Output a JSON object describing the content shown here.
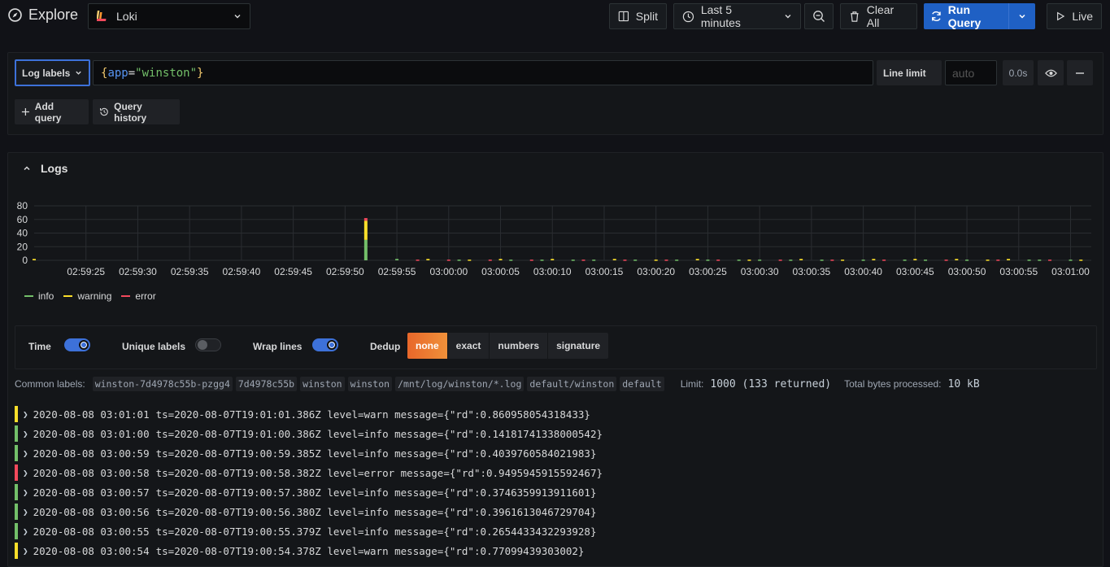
{
  "topbar": {
    "title": "Explore",
    "datasource": "Loki",
    "split_label": "Split",
    "time_range": "Last 5 minutes",
    "clear_all_label": "Clear All",
    "run_query_label": "Run Query",
    "live_label": "Live"
  },
  "query": {
    "log_labels_label": "Log labels",
    "expr_open": "{",
    "expr_key": "app",
    "expr_eq": "=",
    "expr_value": "\"winston\"",
    "expr_close": "}",
    "line_limit_label": "Line limit",
    "line_limit_placeholder": "auto",
    "query_time": "0.0s",
    "add_query_label": "Add query",
    "query_history_label": "Query history"
  },
  "logs": {
    "title": "Logs",
    "options": {
      "time_label": "Time",
      "time_on": true,
      "unique_labels_label": "Unique labels",
      "unique_labels_on": false,
      "wrap_lines_label": "Wrap lines",
      "wrap_lines_on": true,
      "dedup_label": "Dedup",
      "dedup_options": [
        "none",
        "exact",
        "numbers",
        "signature"
      ],
      "dedup_selected": "none"
    },
    "common_labels_label": "Common labels:",
    "common_labels": [
      "winston-7d4978c55b-pzgg4",
      "7d4978c55b",
      "winston",
      "winston",
      "/mnt/log/winston/*.log",
      "default/winston",
      "default"
    ],
    "limit_label": "Limit:",
    "limit_value": "1000 (133 returned)",
    "bytes_label": "Total bytes processed:",
    "bytes_value": "10 kB",
    "rows": [
      {
        "level": "warn",
        "time": "2020-08-08 03:01:01",
        "line": "ts=2020-08-07T19:01:01.386Z level=warn message={\"rd\":0.860958054318433}"
      },
      {
        "level": "info",
        "time": "2020-08-08 03:01:00",
        "line": "ts=2020-08-07T19:01:00.386Z level=info message={\"rd\":0.14181741338000542}"
      },
      {
        "level": "info",
        "time": "2020-08-08 03:00:59",
        "line": "ts=2020-08-07T19:00:59.385Z level=info message={\"rd\":0.4039760584021983}"
      },
      {
        "level": "error",
        "time": "2020-08-08 03:00:58",
        "line": "ts=2020-08-07T19:00:58.382Z level=error message={\"rd\":0.9495945915592467}"
      },
      {
        "level": "info",
        "time": "2020-08-08 03:00:57",
        "line": "ts=2020-08-07T19:00:57.380Z level=info message={\"rd\":0.3746359913911601}"
      },
      {
        "level": "info",
        "time": "2020-08-08 03:00:56",
        "line": "ts=2020-08-07T19:00:56.380Z level=info message={\"rd\":0.3961613046729704}"
      },
      {
        "level": "info",
        "time": "2020-08-08 03:00:55",
        "line": "ts=2020-08-07T19:00:55.379Z level=info message={\"rd\":0.2654433432293928}"
      },
      {
        "level": "warn",
        "time": "2020-08-08 03:00:54",
        "line": "ts=2020-08-07T19:00:54.378Z level=warn message={\"rd\":0.77099439303002}"
      }
    ]
  },
  "colors": {
    "info": "#73bf69",
    "warn": "#fade2a",
    "error": "#f2495c",
    "accent": "#3d71d9"
  },
  "chart_data": {
    "type": "bar",
    "stacked": true,
    "ylim": [
      0,
      80
    ],
    "yticks": [
      0,
      20,
      40,
      60,
      80
    ],
    "x_tick_labels": [
      "02:59:25",
      "02:59:30",
      "02:59:35",
      "02:59:40",
      "02:59:45",
      "02:59:50",
      "02:59:55",
      "03:00:00",
      "03:00:05",
      "03:00:10",
      "03:00:15",
      "03:00:20",
      "03:00:25",
      "03:00:30",
      "03:00:35",
      "03:00:40",
      "03:00:45",
      "03:00:50",
      "03:00:55",
      "03:01:00"
    ],
    "x_start": "02:59:20",
    "x_end": "03:01:02",
    "grid": true,
    "legend_placement": "bottom-left",
    "series": [
      {
        "name": "info",
        "color": "#73bf69"
      },
      {
        "name": "warning",
        "color": "#fade2a"
      },
      {
        "name": "error",
        "color": "#f2495c"
      }
    ],
    "bars": [
      {
        "t": "02:59:20",
        "info": 0,
        "warning": 2,
        "error": 0
      },
      {
        "t": "02:59:52",
        "info": 30,
        "warning": 28,
        "error": 4
      },
      {
        "t": "02:59:55",
        "info": 2,
        "warning": 0,
        "error": 0
      },
      {
        "t": "02:59:57",
        "info": 0,
        "warning": 0,
        "error": 1
      },
      {
        "t": "02:59:58",
        "info": 0,
        "warning": 2,
        "error": 0
      },
      {
        "t": "03:00:00",
        "info": 0,
        "warning": 0,
        "error": 1
      },
      {
        "t": "03:00:01",
        "info": 1,
        "warning": 0,
        "error": 0
      },
      {
        "t": "03:00:02",
        "info": 0,
        "warning": 1,
        "error": 0
      },
      {
        "t": "03:00:04",
        "info": 0,
        "warning": 0,
        "error": 1
      },
      {
        "t": "03:00:05",
        "info": 0,
        "warning": 2,
        "error": 0
      },
      {
        "t": "03:00:06",
        "info": 1,
        "warning": 0,
        "error": 0
      },
      {
        "t": "03:00:08",
        "info": 0,
        "warning": 0,
        "error": 1
      },
      {
        "t": "03:00:09",
        "info": 1,
        "warning": 0,
        "error": 0
      },
      {
        "t": "03:00:10",
        "info": 0,
        "warning": 2,
        "error": 0
      },
      {
        "t": "03:00:12",
        "info": 1,
        "warning": 0,
        "error": 0
      },
      {
        "t": "03:00:13",
        "info": 0,
        "warning": 0,
        "error": 1
      },
      {
        "t": "03:00:14",
        "info": 1,
        "warning": 0,
        "error": 0
      },
      {
        "t": "03:00:16",
        "info": 0,
        "warning": 2,
        "error": 0
      },
      {
        "t": "03:00:17",
        "info": 0,
        "warning": 0,
        "error": 1
      },
      {
        "t": "03:00:18",
        "info": 1,
        "warning": 0,
        "error": 0
      },
      {
        "t": "03:00:20",
        "info": 0,
        "warning": 1,
        "error": 0
      },
      {
        "t": "03:00:21",
        "info": 0,
        "warning": 0,
        "error": 1
      },
      {
        "t": "03:00:22",
        "info": 1,
        "warning": 0,
        "error": 0
      },
      {
        "t": "03:00:24",
        "info": 0,
        "warning": 2,
        "error": 0
      },
      {
        "t": "03:00:25",
        "info": 1,
        "warning": 0,
        "error": 0
      },
      {
        "t": "03:00:26",
        "info": 0,
        "warning": 0,
        "error": 1
      },
      {
        "t": "03:00:28",
        "info": 1,
        "warning": 0,
        "error": 0
      },
      {
        "t": "03:00:29",
        "info": 0,
        "warning": 1,
        "error": 0
      },
      {
        "t": "03:00:30",
        "info": 1,
        "warning": 0,
        "error": 0
      },
      {
        "t": "03:00:32",
        "info": 0,
        "warning": 0,
        "error": 1
      },
      {
        "t": "03:00:33",
        "info": 1,
        "warning": 0,
        "error": 0
      },
      {
        "t": "03:00:34",
        "info": 0,
        "warning": 2,
        "error": 0
      },
      {
        "t": "03:00:36",
        "info": 1,
        "warning": 0,
        "error": 0
      },
      {
        "t": "03:00:37",
        "info": 0,
        "warning": 0,
        "error": 1
      },
      {
        "t": "03:00:38",
        "info": 0,
        "warning": 1,
        "error": 0
      },
      {
        "t": "03:00:40",
        "info": 1,
        "warning": 0,
        "error": 0
      },
      {
        "t": "03:00:41",
        "info": 0,
        "warning": 2,
        "error": 0
      },
      {
        "t": "03:00:42",
        "info": 0,
        "warning": 0,
        "error": 1
      },
      {
        "t": "03:00:44",
        "info": 1,
        "warning": 0,
        "error": 0
      },
      {
        "t": "03:00:45",
        "info": 0,
        "warning": 2,
        "error": 0
      },
      {
        "t": "03:00:46",
        "info": 1,
        "warning": 0,
        "error": 0
      },
      {
        "t": "03:00:48",
        "info": 0,
        "warning": 0,
        "error": 1
      },
      {
        "t": "03:00:49",
        "info": 0,
        "warning": 2,
        "error": 0
      },
      {
        "t": "03:00:50",
        "info": 1,
        "warning": 0,
        "error": 0
      },
      {
        "t": "03:00:52",
        "info": 0,
        "warning": 1,
        "error": 0
      },
      {
        "t": "03:00:53",
        "info": 0,
        "warning": 0,
        "error": 1
      },
      {
        "t": "03:00:54",
        "info": 0,
        "warning": 2,
        "error": 0
      },
      {
        "t": "03:00:56",
        "info": 1,
        "warning": 0,
        "error": 0
      },
      {
        "t": "03:00:57",
        "info": 1,
        "warning": 0,
        "error": 0
      },
      {
        "t": "03:00:58",
        "info": 0,
        "warning": 0,
        "error": 1
      },
      {
        "t": "03:01:00",
        "info": 1,
        "warning": 0,
        "error": 0
      },
      {
        "t": "03:01:01",
        "info": 0,
        "warning": 1,
        "error": 0
      }
    ]
  }
}
